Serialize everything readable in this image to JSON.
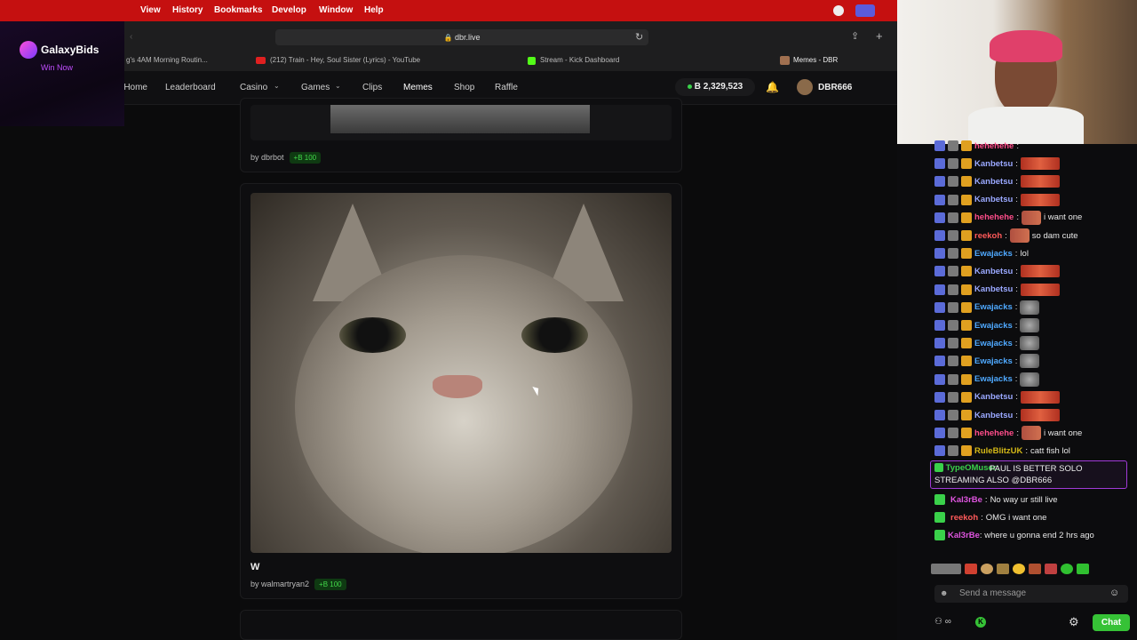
{
  "menubar": {
    "items": [
      "View",
      "History",
      "Bookmarks",
      "Develop",
      "Window",
      "Help"
    ]
  },
  "browser": {
    "url": "dbr.live",
    "tabs": [
      "g's 4AM Morning Routin...",
      "(212) Train - Hey, Soul Sister (Lyrics) - YouTube",
      "Stream - Kick Dashboard",
      "Memes - DBR"
    ]
  },
  "galaxy": {
    "name": "GalaxyBids",
    "cta": "Win Now"
  },
  "nav": {
    "items": [
      "Home",
      "Leaderboard",
      "Casino",
      "Games",
      "Clips",
      "Memes",
      "Shop",
      "Raffle"
    ],
    "balance": "B 2,329,523",
    "username": "DBR666"
  },
  "memes": [
    {
      "caption": "",
      "by": "by dbrbot",
      "reward": "+B 100"
    },
    {
      "caption": "W",
      "by": "by walmartryan2",
      "reward": "+B 100"
    }
  ],
  "chat": {
    "messages": [
      {
        "user": "hehehehe",
        "text": "",
        "color": "#ff4d8a",
        "emote": ""
      },
      {
        "user": "Kanbetsu",
        "text": "",
        "color": "#9aa8ff",
        "emote": "red"
      },
      {
        "user": "Kanbetsu",
        "text": "",
        "color": "#9aa8ff",
        "emote": "red"
      },
      {
        "user": "Kanbetsu",
        "text": "",
        "color": "#9aa8ff",
        "emote": "red"
      },
      {
        "user": "hehehehe",
        "text": "i want one",
        "color": "#ff4d8a",
        "emote": "small"
      },
      {
        "user": "reekoh",
        "text": "so dam cute",
        "color": "#ff5a5a",
        "emote": "small"
      },
      {
        "user": "Ewajacks",
        "text": "lol",
        "color": "#4fa9ff",
        "emote": ""
      },
      {
        "user": "Kanbetsu",
        "text": "",
        "color": "#9aa8ff",
        "emote": "red"
      },
      {
        "user": "Kanbetsu",
        "text": "",
        "color": "#9aa8ff",
        "emote": "red"
      },
      {
        "user": "Ewajacks",
        "text": "",
        "color": "#4fa9ff",
        "emote": "cat"
      },
      {
        "user": "Ewajacks",
        "text": "",
        "color": "#4fa9ff",
        "emote": "cat"
      },
      {
        "user": "Ewajacks",
        "text": "",
        "color": "#4fa9ff",
        "emote": "cat"
      },
      {
        "user": "Ewajacks",
        "text": "",
        "color": "#4fa9ff",
        "emote": "cat"
      },
      {
        "user": "Ewajacks",
        "text": "",
        "color": "#4fa9ff",
        "emote": "cat"
      },
      {
        "user": "Kanbetsu",
        "text": "",
        "color": "#9aa8ff",
        "emote": "red"
      },
      {
        "user": "Kanbetsu",
        "text": "",
        "color": "#9aa8ff",
        "emote": "red"
      },
      {
        "user": "hehehehe",
        "text": "i want one",
        "color": "#ff4d8a",
        "emote": "small"
      },
      {
        "user": "RuleBlitzUK",
        "text": "catt fish lol",
        "color": "#d4b817",
        "emote": ""
      }
    ],
    "highlight": {
      "user": "TypeOMuser",
      "text": "PAUL IS BETTER SOLO STREAMING ALSO @DBR666"
    },
    "messages2": [
      {
        "user": "Kal3rBe",
        "text": "No way ur still live",
        "color": "#e055e0"
      },
      {
        "user": "reekoh",
        "text": "OMG i want one",
        "color": "#ff5a5a"
      },
      {
        "user": "Kal3rBe",
        "text": "where u gonna end 2 hrs ago",
        "color": "#e055e0"
      }
    ],
    "placeholder": "Send a message",
    "chat_button": "Chat"
  }
}
